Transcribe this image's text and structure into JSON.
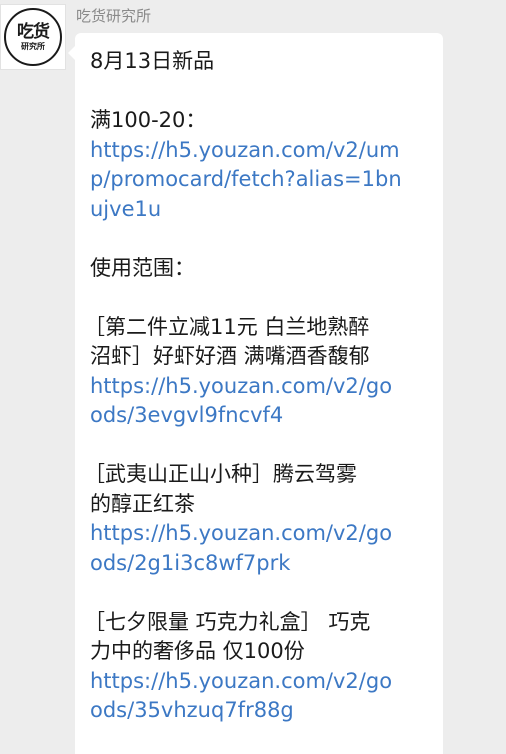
{
  "chat": {
    "sender_name": "吃货研究所",
    "avatar": {
      "icon": "chihuo-logo",
      "big_text": "吃货",
      "small_text": "研究所"
    }
  },
  "message": {
    "title": "8月13日新品",
    "promo_label": "满100-20：",
    "promo_link_lines": [
      "https://h5.youzan.com/v2/um",
      "p/promocard/fetch?alias=1bn",
      "ujve1u"
    ],
    "scope_label": "使用范围：",
    "products": [
      {
        "title_lines": [
          "［第二件立减11元 白兰地熟醉",
          "沼虾］好虾好酒 满嘴酒香馥郁"
        ],
        "link_lines": [
          "https://h5.youzan.com/v2/go",
          "ods/3evgvl9fncvf4"
        ]
      },
      {
        "title_lines": [
          "［武夷山正山小种］腾云驾雾",
          "的醇正红茶"
        ],
        "link_lines": [
          "https://h5.youzan.com/v2/go",
          "ods/2g1i3c8wf7prk"
        ]
      },
      {
        "title_lines": [
          "［七夕限量 巧克力礼盒］ 巧克",
          "力中的奢侈品 仅100份"
        ],
        "link_lines": [
          "https://h5.youzan.com/v2/go",
          "ods/35vhzuq7fr88g"
        ]
      }
    ]
  },
  "colors": {
    "background": "#ededed",
    "bubble": "#ffffff",
    "text": "#1a1a1a",
    "link": "#3c78c4",
    "sender": "#8a8a8a"
  }
}
